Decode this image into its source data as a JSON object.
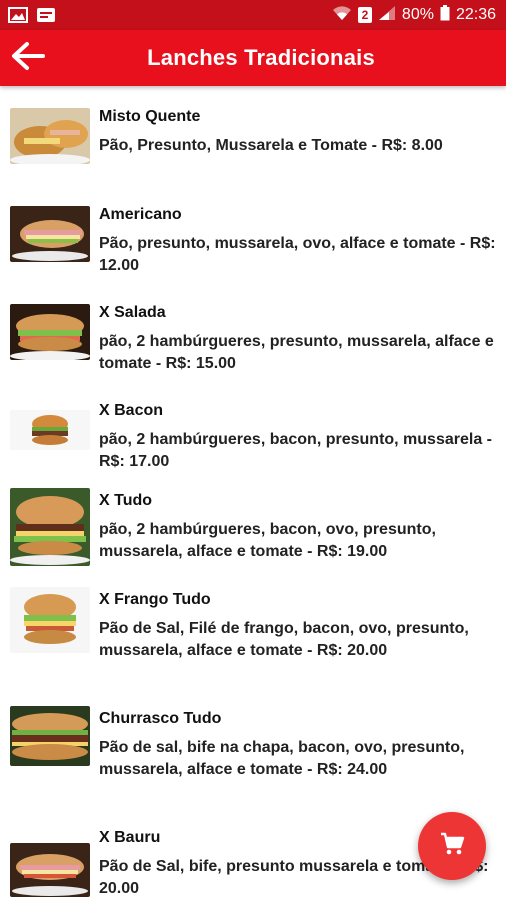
{
  "status_bar": {
    "battery": "80%",
    "time": "22:36",
    "sim_badge": "2",
    "icons": [
      "image-icon",
      "notification-icon",
      "wifi-icon",
      "signal-icon",
      "battery-icon"
    ]
  },
  "app_bar": {
    "title": "Lanches Tradicionais",
    "back_icon": "arrow-left-icon"
  },
  "colors": {
    "status_bar": "#c4101a",
    "app_bar": "#e8101c",
    "fab": "#ee3535",
    "text": "#111111"
  },
  "items": [
    {
      "name": "Misto Quente",
      "description": "Pão, Presunto, Mussarela e Tomate - R$: 8.00"
    },
    {
      "name": "Americano",
      "description": "Pão, presunto, mussarela, ovo, alface e tomate - R$: 12.00"
    },
    {
      "name": "X Salada",
      "description": "pão, 2 hambúrgueres, presunto, mussarela, alface e tomate - R$: 15.00"
    },
    {
      "name": "X Bacon",
      "description": "pão, 2 hambúrgueres, bacon, presunto, mussarela - R$: 17.00"
    },
    {
      "name": "X Tudo",
      "description": "pão, 2 hambúrgueres, bacon, ovo, presunto, mussarela, alface e tomate - R$: 19.00"
    },
    {
      "name": "X Frango Tudo",
      "description": "Pão de Sal, Filé de frango, bacon, ovo, presunto, mussarela, alface e tomate - R$: 20.00"
    },
    {
      "name": "Churrasco Tudo",
      "description": "Pão de sal, bife na chapa, bacon, ovo, presunto, mussarela, alface e tomate - R$: 24.00"
    },
    {
      "name": "X Bauru",
      "description": "Pão de Sal, bife, presunto mussarela e tomate - R$: 20.00"
    }
  ],
  "fab": {
    "icon": "cart-icon"
  }
}
